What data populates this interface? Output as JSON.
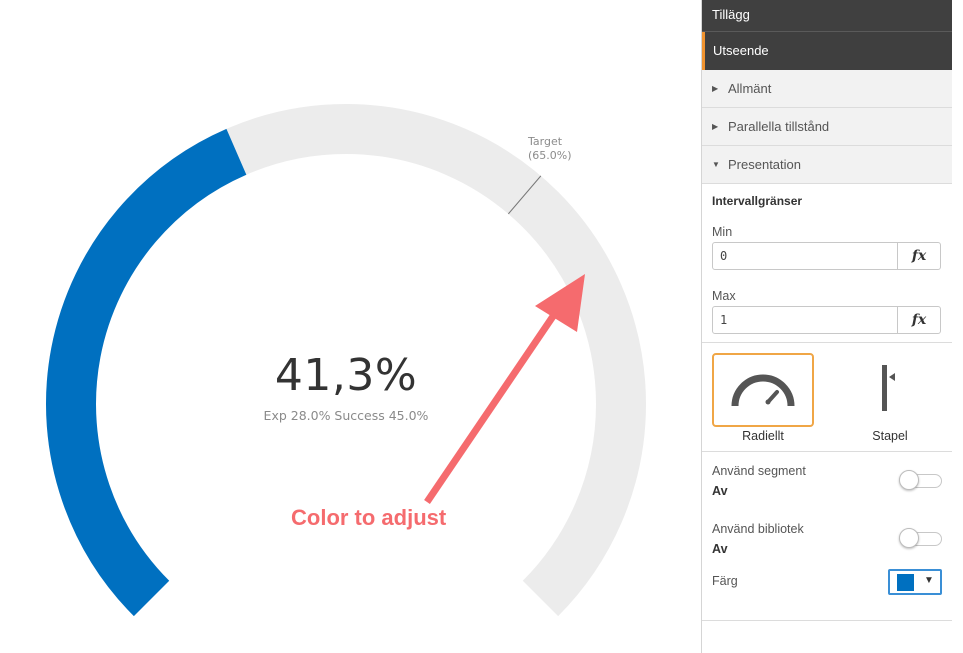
{
  "gauge": {
    "value_text": "41,3%",
    "secondary_text": "Exp 28.0%  Success 45.0%",
    "target_label": "Target",
    "target_value": "(65.0%)",
    "value_fraction": 0.413,
    "target_fraction": 0.65,
    "fill_color": "#0070c0",
    "track_color": "#ececec"
  },
  "annotation": {
    "text": "Color to adjust",
    "color": "#f56b6e"
  },
  "panel": {
    "header_addons": "Tillägg",
    "header_appearance": "Utseende",
    "section_general": "Allmänt",
    "section_alternate_states": "Parallella tillstånd",
    "section_presentation": "Presentation",
    "range_title": "Intervallgränser",
    "min_label": "Min",
    "min_value": "0",
    "max_label": "Max",
    "max_value": "1",
    "fx_label": "fx",
    "type_radial": "Radiellt",
    "type_bar": "Stapel",
    "use_segments_label": "Använd segment",
    "use_segments_value": "Av",
    "use_library_label": "Använd bibliotek",
    "use_library_value": "Av",
    "color_label": "Färg",
    "selected_color": "#0070c0",
    "accent_color": "#f0a646"
  }
}
